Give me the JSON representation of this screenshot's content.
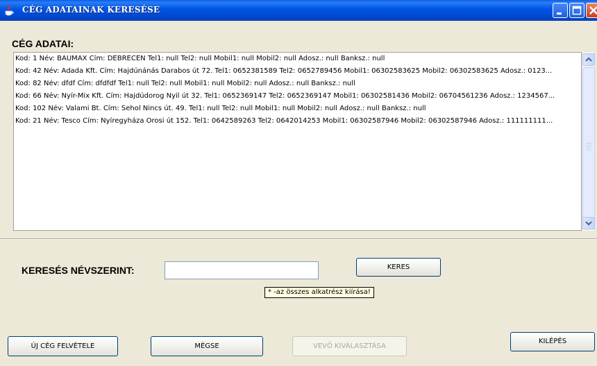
{
  "window": {
    "title": "CÉG ADATAINAK KERESÉSE"
  },
  "section": {
    "label": "CÉG ADATAI:"
  },
  "list": {
    "items": [
      "Kod: 1 Név: BAUMAX Cím: DEBRECEN Tel1: null Tel2: null Mobil1: null Mobil2: null Adosz.: null Banksz.: null",
      "Kod: 42 Név: Adada Kft. Cím: Hajdúnánás Darabos út 72. Tel1: 0652381589 Tel2: 0652789456 Mobil1: 06302583625 Mobil2: 06302583625 Adosz.: 0123...",
      "Kod: 82 Név: dfdf Cím: dfdfdf Tel1: null Tel2: null Mobil1: null Mobil2: null Adosz.: null Banksz.: null",
      "Kod: 66 Név: Nyír-Mix Kft. Cím: Hajdúdorog Nyil út 32. Tel1: 0652369147 Tel2: 0652369147 Mobil1: 06302581436 Mobil2: 06704561236 Adosz.: 1234567...",
      "Kod: 102 Név: Valami Bt. Cím: Sehol Nincs út. 49. Tel1: null Tel2: null Mobil1: null Mobil2: null Adosz.: null Banksz.: null",
      "Kod: 21 Név: Tesco Cím: Nyíregyháza Orosi út 152. Tel1: 0642589263 Tel2: 0642014253 Mobil1: 06302587946 Mobil2: 06302587946 Adosz.: 111111111..."
    ]
  },
  "search": {
    "label": "KERESÉS NÉVSZERINT:",
    "value": "",
    "button_label": "KERES",
    "tooltip": "* -az összes alkatrész kiírása!"
  },
  "footer": {
    "new_company_label": "ÚJ CÉG FELVÉTELE",
    "cancel_label": "MÉGSE",
    "select_buyer_label": "VEVŐ KIVÁLASZTÁSA",
    "exit_label": "KILÉPÉS"
  },
  "icons": {
    "app": "java-cup-icon",
    "minimize": "minimize-icon",
    "maximize": "maximize-icon",
    "close": "close-icon",
    "scroll_up": "chevron-up-icon",
    "scroll_down": "chevron-down-icon"
  },
  "colors": {
    "titlebar": "#0055e5",
    "window_bg": "#ece9d8",
    "close_button": "#c9401e",
    "tooltip_bg": "#ffffe1"
  }
}
